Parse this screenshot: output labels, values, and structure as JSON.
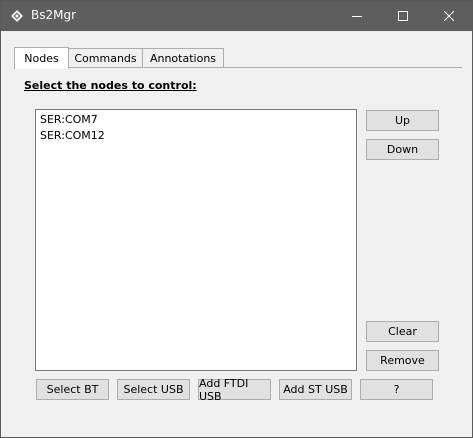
{
  "window": {
    "title": "Bs2Mgr"
  },
  "tabs": [
    {
      "label": "Nodes",
      "active": true
    },
    {
      "label": "Commands",
      "active": false
    },
    {
      "label": "Annotations",
      "active": false
    }
  ],
  "nodes": {
    "section_label": "Select the nodes to control:",
    "items": [
      "SER:COM7",
      "SER:COM12"
    ]
  },
  "side_buttons": {
    "up": "Up",
    "down": "Down",
    "clear": "Clear",
    "remove": "Remove"
  },
  "bottom_buttons": {
    "select_bt": "Select BT",
    "select_usb": "Select USB",
    "add_ftdi_usb": "Add FTDI USB",
    "add_st_usb": "Add ST USB",
    "help": "?"
  },
  "colors": {
    "titlebar": "#5e5e5e",
    "window_bg": "#f0f0f0",
    "button_bg": "#e1e1e1"
  }
}
